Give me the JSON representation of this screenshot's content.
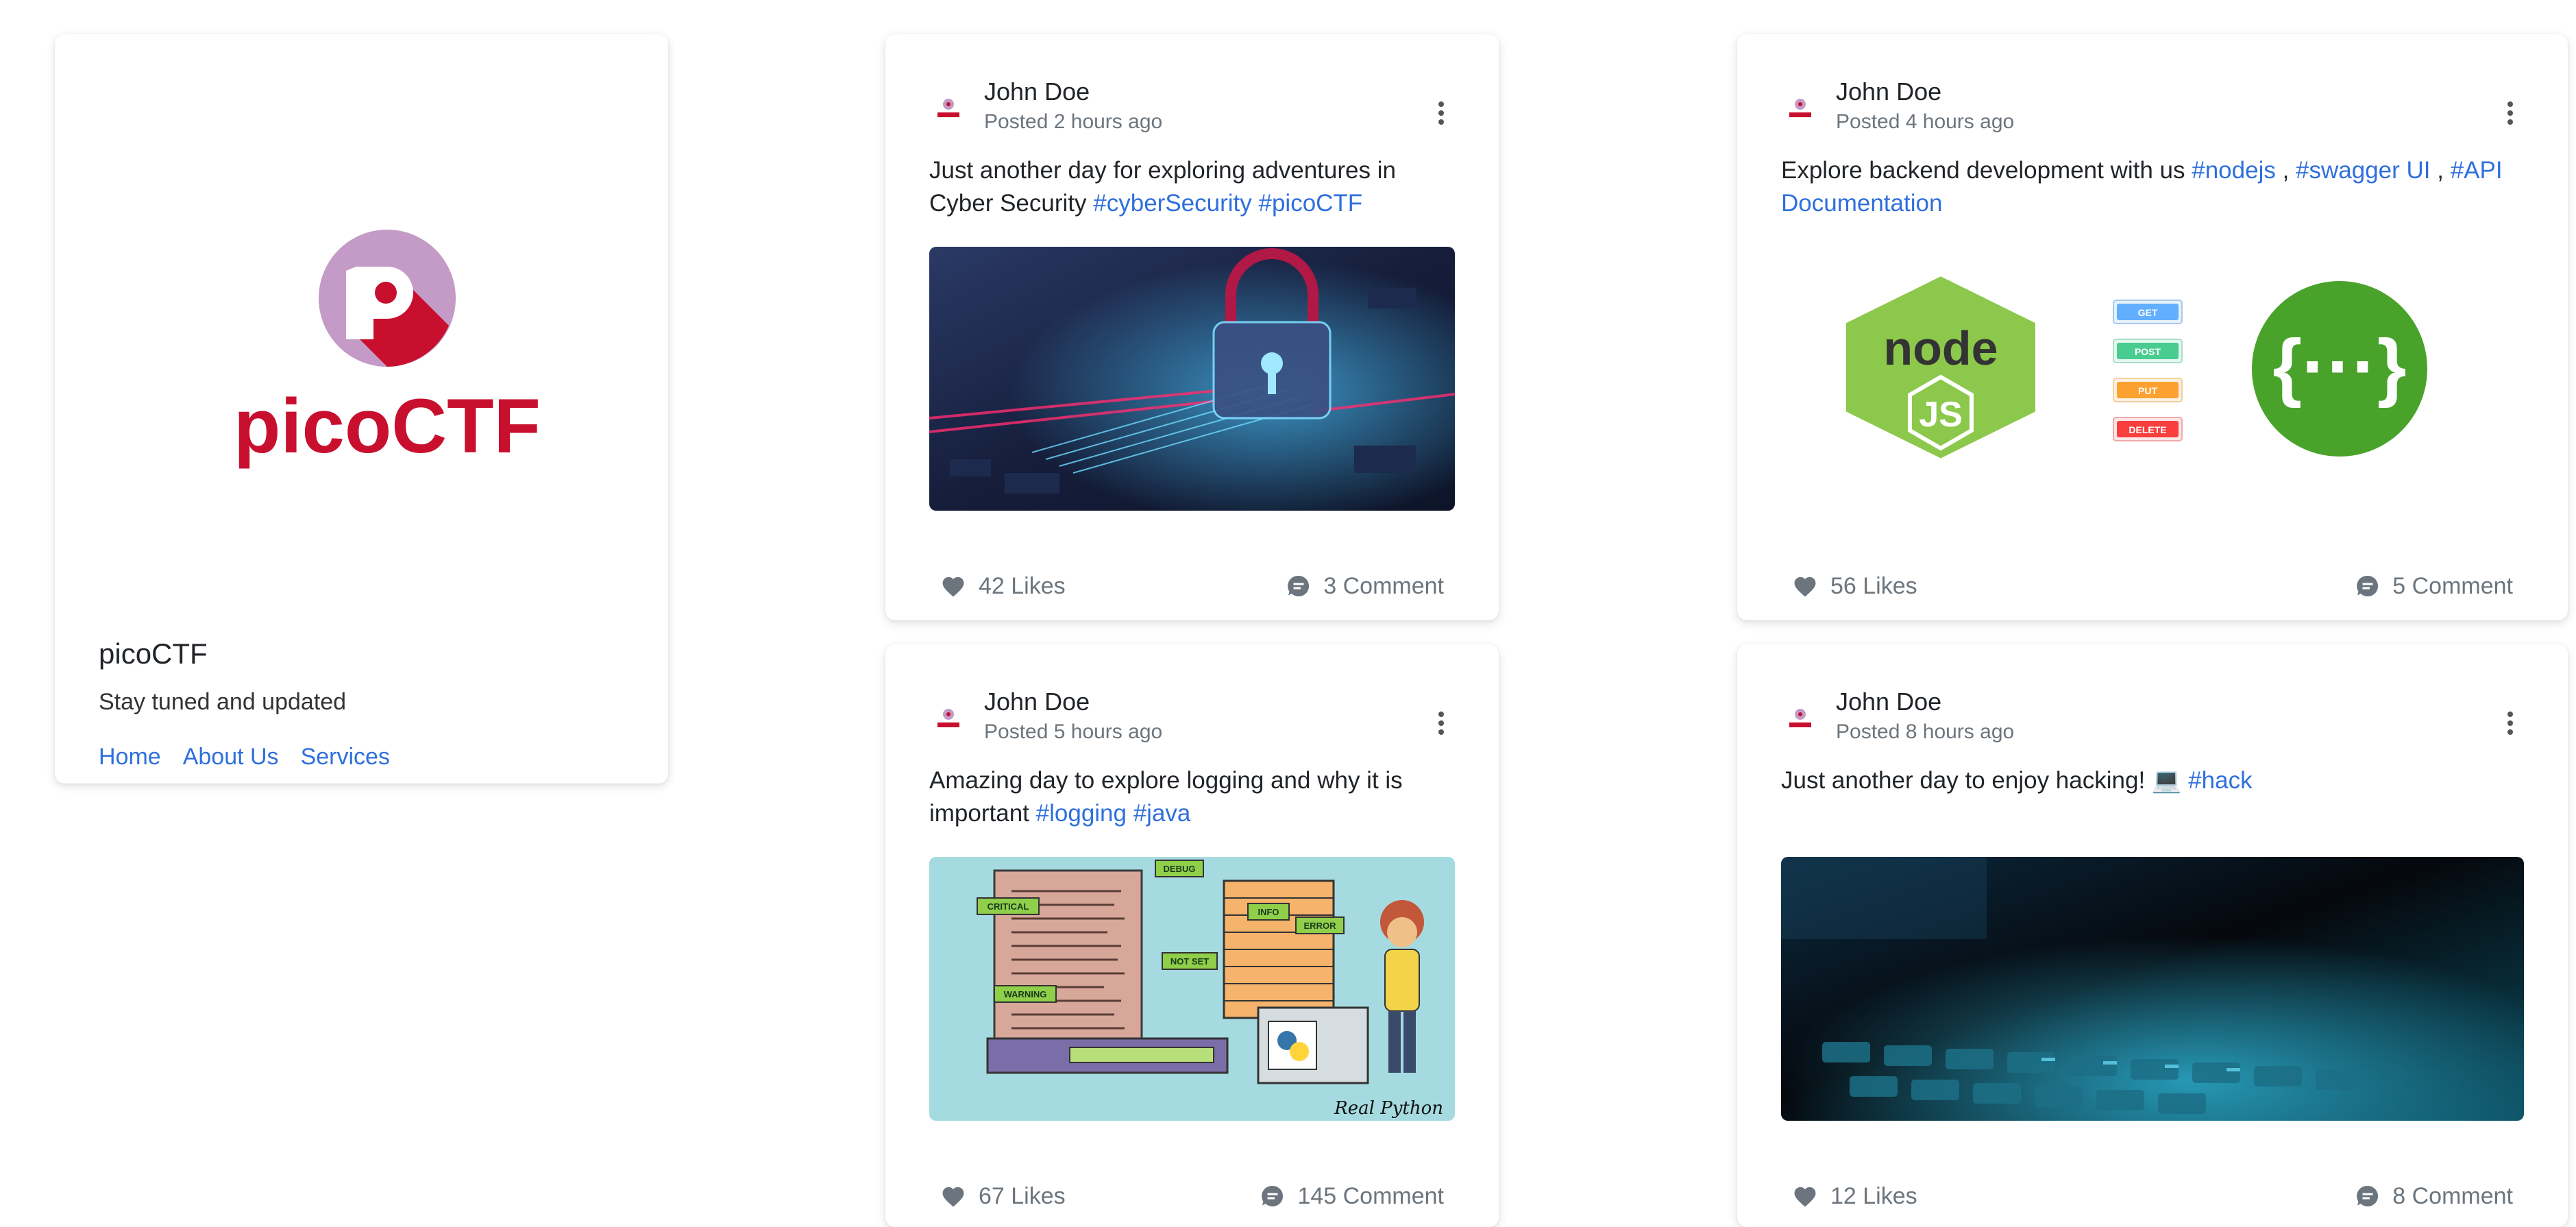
{
  "profile": {
    "logo_text": "picoCTF",
    "name": "picoCTF",
    "tagline": "Stay tuned and updated",
    "links": [
      "Home",
      "About Us",
      "Services"
    ]
  },
  "posts": [
    {
      "author": "John Doe",
      "time": "Posted 2 hours ago",
      "text": "Just another day for exploring adventures in Cyber Security",
      "tags": [
        "#cyberSecurity",
        "#picoCTF"
      ],
      "likes": "42 Likes",
      "comments": "3 Comment"
    },
    {
      "author": "John Doe",
      "time": "Posted 4 hours ago",
      "text": "Explore backend development with us",
      "tags": [
        "#nodejs",
        "#swagger UI",
        "#API Documentation"
      ],
      "likes": "56 Likes",
      "comments": "5 Comment",
      "media_labels": {
        "node_top": "node",
        "node_js": "JS",
        "methods": [
          "GET",
          "POST",
          "PUT",
          "DELETE"
        ],
        "swagger_symbol": "{···}"
      }
    },
    {
      "author": "John Doe",
      "time": "Posted 5 hours ago",
      "text": "Amazing day to explore logging and why it is important",
      "tags": [
        "#logging",
        "#java"
      ],
      "likes": "67 Likes",
      "comments": "145 Comment",
      "media_labels": {
        "levels": [
          "DEBUG",
          "CRITICAL",
          "INFO",
          "ERROR",
          "NOT SET",
          "WARNING"
        ],
        "brand": "Real Python"
      }
    },
    {
      "author": "John Doe",
      "time": "Posted 8 hours ago",
      "text": "Just another day to enjoy hacking! 💻",
      "tags": [
        "#hack"
      ],
      "likes": "12 Likes",
      "comments": "8 Comment"
    }
  ],
  "icons": {
    "like": "heart-icon",
    "comment": "comment-icon",
    "menu": "more-vertical-icon"
  },
  "colors": {
    "link": "#2f6fde",
    "pico_red": "#c8102e",
    "pico_lilac": "#c49ac6",
    "node_green": "#8cc84b",
    "swagger_green": "#49a32b"
  }
}
